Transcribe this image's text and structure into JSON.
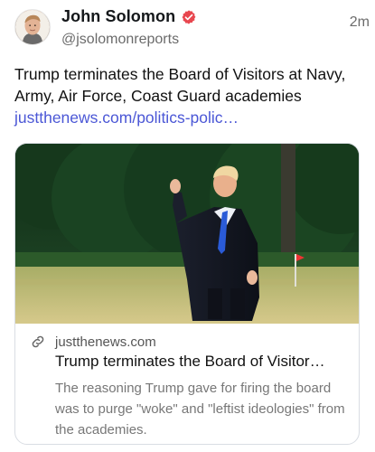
{
  "author": {
    "display_name": "John Solomon",
    "handle": "@jsolomonreports",
    "verified_icon": "verified-badge-icon",
    "avatar_icon": "avatar"
  },
  "timestamp": "2m",
  "post": {
    "text": "Trump terminates the Board of Visitors at Navy, Army, Air Force, Coast Guard academies ",
    "link_text": "justthenews.com/politics-polic…"
  },
  "card": {
    "domain": "justthenews.com",
    "title": "Trump terminates the Board of Visitor…",
    "description": "The reasoning Trump gave for firing the board was to purge \"woke\" and \"leftist ideologies\" from the academies.",
    "link_icon": "link-icon"
  },
  "colors": {
    "link": "#4b57d6",
    "verified": "#e8474f",
    "muted": "#6b6b6b"
  }
}
